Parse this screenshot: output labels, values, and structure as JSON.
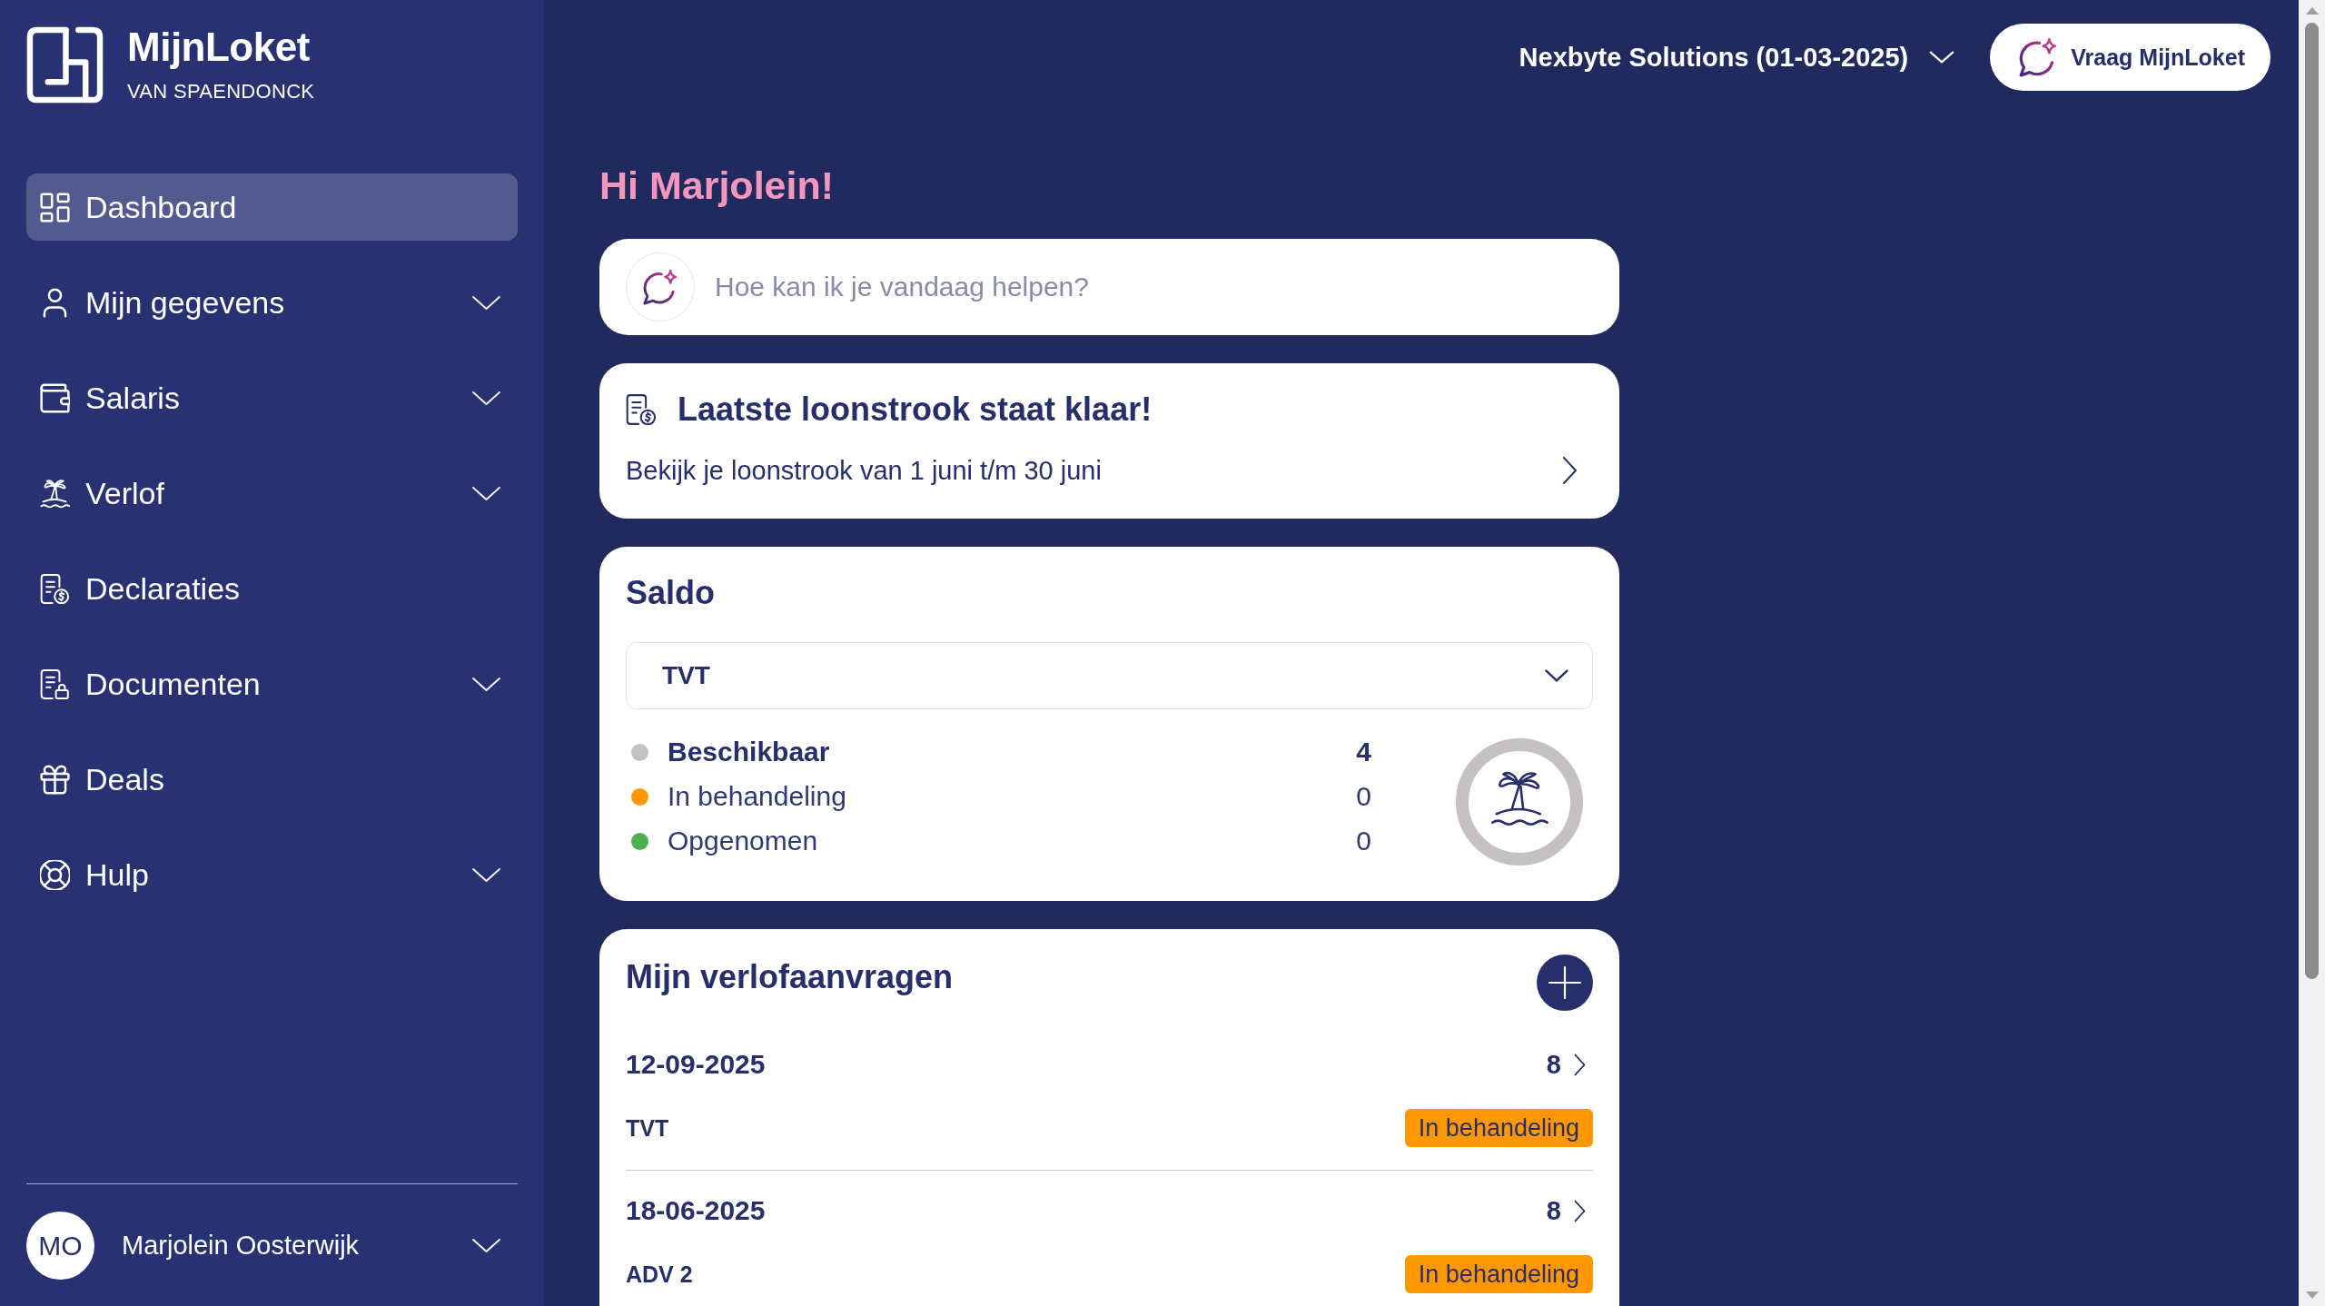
{
  "sidebar": {
    "logo": {
      "title": "MijnLoket",
      "subtitle": "VAN SPAENDONCK"
    },
    "items": [
      {
        "label": "Dashboard",
        "selected": true,
        "expandable": false
      },
      {
        "label": "Mijn gegevens",
        "selected": false,
        "expandable": true
      },
      {
        "label": "Salaris",
        "selected": false,
        "expandable": true
      },
      {
        "label": "Verlof",
        "selected": false,
        "expandable": true
      },
      {
        "label": "Declaraties",
        "selected": false,
        "expandable": false
      },
      {
        "label": "Documenten",
        "selected": false,
        "expandable": true
      },
      {
        "label": "Deals",
        "selected": false,
        "expandable": false
      },
      {
        "label": "Hulp",
        "selected": false,
        "expandable": true
      }
    ],
    "user": {
      "initials": "MO",
      "name": "Marjolein Oosterwijk"
    }
  },
  "header": {
    "employer_selector": "Nexbyte Solutions (01-03-2025)",
    "assistant_button": "Vraag MijnLoket"
  },
  "greeting": "Hi Marjolein!",
  "assistant_input": {
    "placeholder": "Hoe kan ik je vandaag helpen?"
  },
  "payslip_card": {
    "title": "Laatste loonstrook staat klaar!",
    "text": "Bekijk je loonstrook van 1 juni t/m 30 juni"
  },
  "saldo": {
    "title": "Saldo",
    "leave_type": "TVT",
    "legend": [
      {
        "label": "Beschikbaar",
        "value": "4",
        "color": "#c4c0c4",
        "highlighted": true
      },
      {
        "label": "In behandeling",
        "value": "0",
        "color": "#ff9800",
        "highlighted": false
      },
      {
        "label": "Opgenomen",
        "value": "0",
        "color": "#4caf50",
        "highlighted": false
      }
    ]
  },
  "leave_requests": {
    "title": "Mijn verlofaanvragen",
    "rows": [
      {
        "date": "12-09-2025",
        "hours": "8",
        "type": "TVT",
        "status": "In behandeling"
      },
      {
        "date": "18-06-2025",
        "hours": "8",
        "type": "ADV 2",
        "status": "In behandeling"
      }
    ]
  }
}
